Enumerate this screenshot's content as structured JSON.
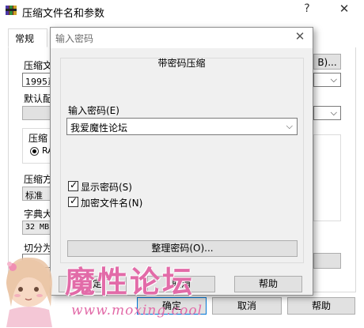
{
  "background_dialog": {
    "title": "压缩文件名和参数",
    "help_glyph": "?",
    "close_glyph": "✕",
    "tab_general": "常规",
    "archive_name_label": "压缩文",
    "archive_name_value": "1995系",
    "browse_button": "B)...",
    "default_profile_label": "默认配",
    "format_label": "压缩",
    "format_rar": "RA",
    "method_label": "压缩方",
    "method_value": "标准",
    "dict_label": "字典大",
    "dict_value": "32 MB",
    "split_label": "切分为",
    "ok_button": "确定",
    "cancel_button": "取消",
    "help_button": "帮助"
  },
  "password_dialog": {
    "title": "输入密码",
    "close_glyph": "✕",
    "group_title": "带密码压缩",
    "password_label": "输入密码(E)",
    "password_value": "我爱魔性论坛",
    "show_password": {
      "label": "显示密码(S)",
      "checked": true
    },
    "encrypt_filenames": {
      "label": "加密文件名(N)",
      "checked": true
    },
    "organize_button": "整理密码(O)...",
    "ok_button": "确定",
    "cancel_button": "取消",
    "help_button": "帮助"
  },
  "watermark": {
    "text": "魔性论坛",
    "url": "www.moxing.cool"
  },
  "colors": {
    "watermark": "#e26ba8",
    "dialog_bg": "#f0f0f0",
    "button_face": "#e1e1e1",
    "default_button_border": "#0078d7"
  }
}
